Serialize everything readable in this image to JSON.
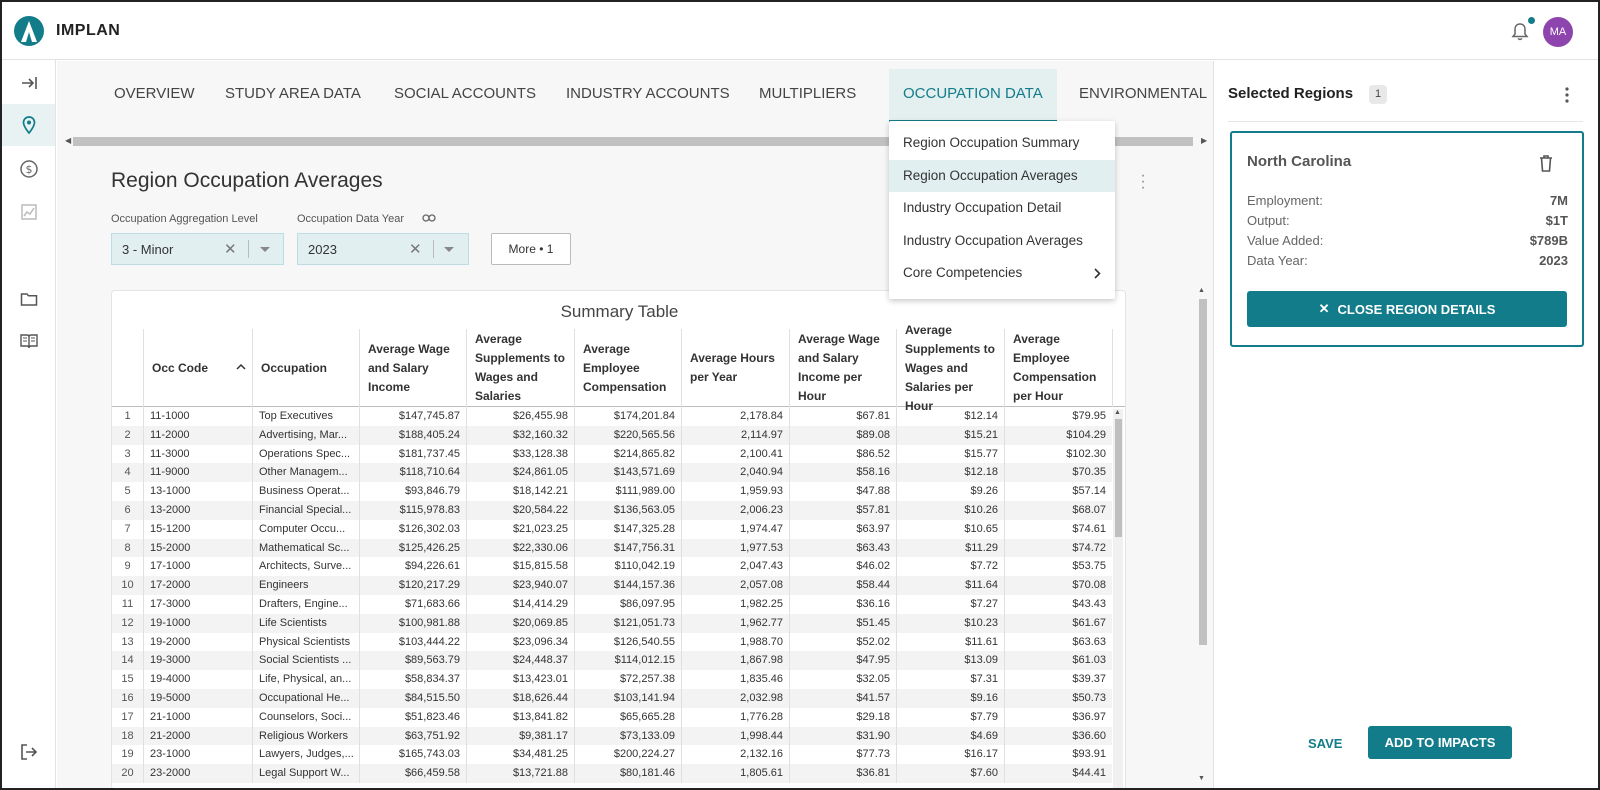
{
  "app": {
    "brand": "IMPLAN",
    "avatar_initials": "MA",
    "accent": "#127c8a",
    "avatar_color": "#8e44ad"
  },
  "rail": [
    {
      "icon": "expand-arrow-icon"
    },
    {
      "icon": "location-pin-icon",
      "active": true
    },
    {
      "icon": "dollar-circle-icon"
    },
    {
      "icon": "line-chart-icon"
    },
    {
      "icon": "folder-icon"
    },
    {
      "icon": "book-icon"
    },
    {
      "icon": "logout-icon"
    }
  ],
  "tabs": [
    "OVERVIEW",
    "STUDY AREA DATA",
    "SOCIAL ACCOUNTS",
    "INDUSTRY ACCOUNTS",
    "MULTIPLIERS",
    "OCCUPATION DATA",
    "ENVIRONMENTAL"
  ],
  "active_tab": "OCCUPATION DATA",
  "page": {
    "title": "Region Occupation Averages",
    "filters": {
      "aggregation_label": "Occupation Aggregation Level",
      "aggregation_value": "3 - Minor",
      "year_label": "Occupation Data Year",
      "year_value": "2023",
      "more_label": "More • 1"
    }
  },
  "dropdown": {
    "items": [
      "Region Occupation Summary",
      "Region Occupation Averages",
      "Industry Occupation Detail",
      "Industry Occupation Averages",
      "Core Competencies"
    ],
    "active_index": 1
  },
  "table": {
    "title": "Summary Table",
    "headers": [
      "Occ Code",
      "Occupation",
      "Average Wage and Salary Income",
      "Average Supplements to Wages and Salaries",
      "Average Employee Compensation",
      "Average Hours per Year",
      "Average Wage and Salary Income per Hour",
      "Average Supplements to Wages and Salaries per Hour",
      "Average Employee Compensation per Hour"
    ],
    "rows": [
      [
        "1",
        "11-1000",
        "Top Executives",
        "$147,745.87",
        "$26,455.98",
        "$174,201.84",
        "2,178.84",
        "$67.81",
        "$12.14",
        "$79.95"
      ],
      [
        "2",
        "11-2000",
        "Advertising, Mar...",
        "$188,405.24",
        "$32,160.32",
        "$220,565.56",
        "2,114.97",
        "$89.08",
        "$15.21",
        "$104.29"
      ],
      [
        "3",
        "11-3000",
        "Operations Spec...",
        "$181,737.45",
        "$33,128.38",
        "$214,865.82",
        "2,100.41",
        "$86.52",
        "$15.77",
        "$102.30"
      ],
      [
        "4",
        "11-9000",
        "Other Managem...",
        "$118,710.64",
        "$24,861.05",
        "$143,571.69",
        "2,040.94",
        "$58.16",
        "$12.18",
        "$70.35"
      ],
      [
        "5",
        "13-1000",
        "Business Operat...",
        "$93,846.79",
        "$18,142.21",
        "$111,989.00",
        "1,959.93",
        "$47.88",
        "$9.26",
        "$57.14"
      ],
      [
        "6",
        "13-2000",
        "Financial Special...",
        "$115,978.83",
        "$20,584.22",
        "$136,563.05",
        "2,006.23",
        "$57.81",
        "$10.26",
        "$68.07"
      ],
      [
        "7",
        "15-1200",
        "Computer Occu...",
        "$126,302.03",
        "$21,023.25",
        "$147,325.28",
        "1,974.47",
        "$63.97",
        "$10.65",
        "$74.61"
      ],
      [
        "8",
        "15-2000",
        "Mathematical Sc...",
        "$125,426.25",
        "$22,330.06",
        "$147,756.31",
        "1,977.53",
        "$63.43",
        "$11.29",
        "$74.72"
      ],
      [
        "9",
        "17-1000",
        "Architects, Surve...",
        "$94,226.61",
        "$15,815.58",
        "$110,042.19",
        "2,047.43",
        "$46.02",
        "$7.72",
        "$53.75"
      ],
      [
        "10",
        "17-2000",
        "Engineers",
        "$120,217.29",
        "$23,940.07",
        "$144,157.36",
        "2,057.08",
        "$58.44",
        "$11.64",
        "$70.08"
      ],
      [
        "11",
        "17-3000",
        "Drafters, Engine...",
        "$71,683.66",
        "$14,414.29",
        "$86,097.95",
        "1,982.25",
        "$36.16",
        "$7.27",
        "$43.43"
      ],
      [
        "12",
        "19-1000",
        "Life Scientists",
        "$100,981.88",
        "$20,069.85",
        "$121,051.73",
        "1,962.77",
        "$51.45",
        "$10.23",
        "$61.67"
      ],
      [
        "13",
        "19-2000",
        "Physical Scientists",
        "$103,444.22",
        "$23,096.34",
        "$126,540.55",
        "1,988.70",
        "$52.02",
        "$11.61",
        "$63.63"
      ],
      [
        "14",
        "19-3000",
        "Social Scientists ...",
        "$89,563.79",
        "$24,448.37",
        "$114,012.15",
        "1,867.98",
        "$47.95",
        "$13.09",
        "$61.03"
      ],
      [
        "15",
        "19-4000",
        "Life, Physical, an...",
        "$58,834.37",
        "$13,423.01",
        "$72,257.38",
        "1,835.46",
        "$32.05",
        "$7.31",
        "$39.37"
      ],
      [
        "16",
        "19-5000",
        "Occupational He...",
        "$84,515.50",
        "$18,626.44",
        "$103,141.94",
        "2,032.98",
        "$41.57",
        "$9.16",
        "$50.73"
      ],
      [
        "17",
        "21-1000",
        "Counselors, Soci...",
        "$51,823.46",
        "$13,841.82",
        "$65,665.28",
        "1,776.28",
        "$29.18",
        "$7.79",
        "$36.97"
      ],
      [
        "18",
        "21-2000",
        "Religious Workers",
        "$63,751.92",
        "$9,381.17",
        "$73,133.09",
        "1,998.44",
        "$31.90",
        "$4.69",
        "$36.60"
      ],
      [
        "19",
        "23-1000",
        "Lawyers, Judges,...",
        "$165,743.03",
        "$34,481.25",
        "$200,224.27",
        "2,132.16",
        "$77.73",
        "$16.17",
        "$93.91"
      ],
      [
        "20",
        "23-2000",
        "Legal Support W...",
        "$66,459.58",
        "$13,721.88",
        "$80,181.46",
        "1,805.61",
        "$36.81",
        "$7.60",
        "$44.41"
      ]
    ]
  },
  "right_panel": {
    "title": "Selected Regions",
    "count": "1",
    "region": {
      "name": "North Carolina",
      "stats": [
        {
          "label": "Employment:",
          "value": "7M"
        },
        {
          "label": "Output:",
          "value": "$1T"
        },
        {
          "label": "Value Added:",
          "value": "$789B"
        },
        {
          "label": "Data Year:",
          "value": "2023"
        }
      ],
      "close_label": "CLOSE REGION DETAILS"
    },
    "save_label": "SAVE",
    "add_label": "ADD TO IMPACTS"
  }
}
